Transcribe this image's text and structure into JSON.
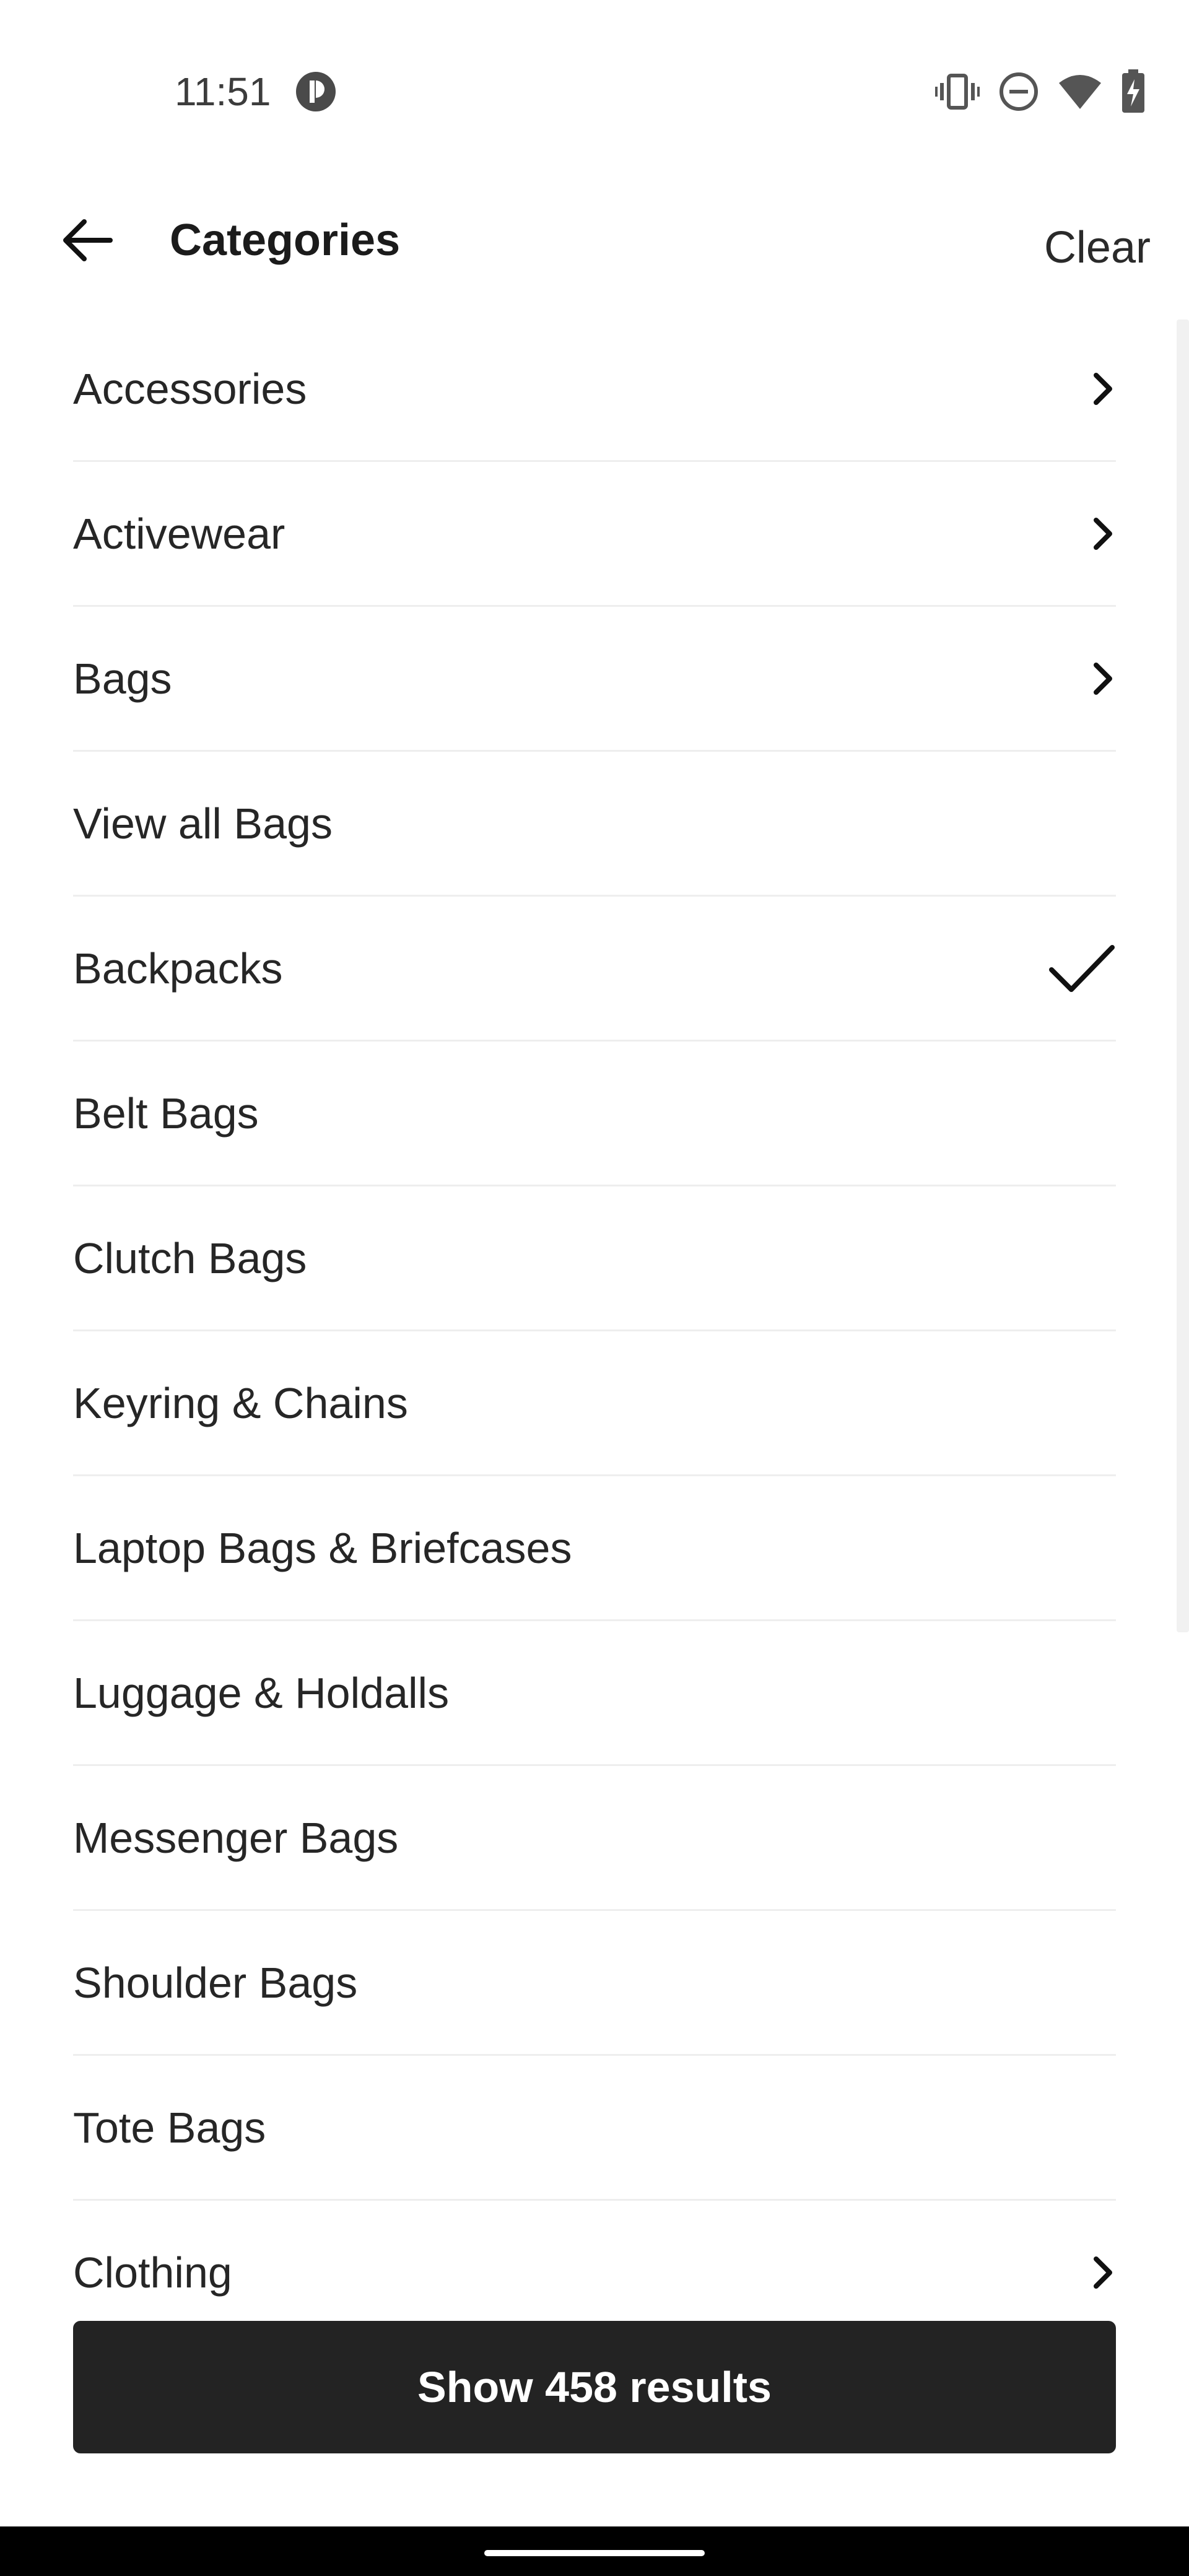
{
  "status_bar": {
    "time": "11:51",
    "icons": [
      "vibrate-icon",
      "do-not-disturb-icon",
      "wifi-icon",
      "battery-charging-icon"
    ]
  },
  "app_bar": {
    "title": "Categories",
    "clear_label": "Clear",
    "back_icon": "arrow-back-icon"
  },
  "categories": [
    {
      "label": "Accessories",
      "trail": "chevron-right-icon"
    },
    {
      "label": "Activewear",
      "trail": "chevron-right-icon"
    },
    {
      "label": "Bags",
      "trail": "chevron-right-icon"
    },
    {
      "label": "View all Bags",
      "trail": ""
    },
    {
      "label": "Backpacks",
      "trail": "check-icon",
      "selected": true
    },
    {
      "label": "Belt Bags",
      "trail": ""
    },
    {
      "label": "Clutch Bags",
      "trail": ""
    },
    {
      "label": "Keyring & Chains",
      "trail": ""
    },
    {
      "label": "Laptop Bags & Briefcases",
      "trail": ""
    },
    {
      "label": "Luggage & Holdalls",
      "trail": ""
    },
    {
      "label": "Messenger Bags",
      "trail": ""
    },
    {
      "label": "Shoulder Bags",
      "trail": ""
    },
    {
      "label": "Tote Bags",
      "trail": ""
    },
    {
      "label": "Clothing",
      "trail": "chevron-right-icon"
    }
  ],
  "show_button": {
    "label": "Show 458 results"
  },
  "colors": {
    "button_bg": "#232323",
    "divider": "#eeeeee",
    "text": "#262626"
  }
}
